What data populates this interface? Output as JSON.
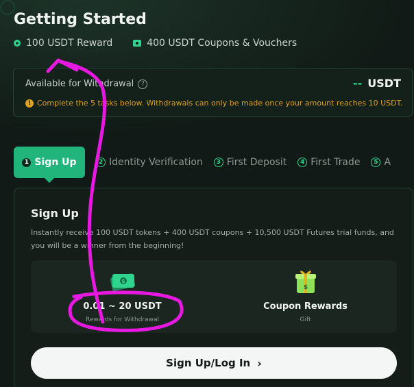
{
  "header": {
    "title": "Getting Started",
    "reward_label": "100 USDT Reward",
    "coupon_label": "400 USDT Coupons & Vouchers"
  },
  "withdrawal": {
    "label": "Available for Withdrawal",
    "amount_placeholder": "--",
    "currency": "USDT",
    "note": "Complete the 5 tasks below. Withdrawals can only be made once your amount reaches 10 USDT."
  },
  "tabs": [
    {
      "num": "1",
      "label": "Sign Up",
      "active": true
    },
    {
      "num": "2",
      "label": "Identity Verification"
    },
    {
      "num": "3",
      "label": "First Deposit"
    },
    {
      "num": "4",
      "label": "First Trade"
    },
    {
      "num": "5",
      "label": "A"
    }
  ],
  "panel": {
    "title": "Sign Up",
    "description": "Instantly receive 100 USDT tokens + 400 USDT coupons + 10,500 USDT Futures trial funds, and you will be a winner from the beginning!",
    "rewards": [
      {
        "value": "0.01 ~ 20 USDT",
        "sub": "Rewards for Withdrawal",
        "icon": "cash-icon"
      },
      {
        "value": "Coupon Rewards",
        "sub": "Gift",
        "icon": "gift-icon"
      }
    ],
    "cta_label": "Sign Up/Log In",
    "cta_chevron": "›"
  },
  "colors": {
    "accent": "#21b57c",
    "warning": "#e0a11c",
    "annotation": "#e619e0"
  }
}
